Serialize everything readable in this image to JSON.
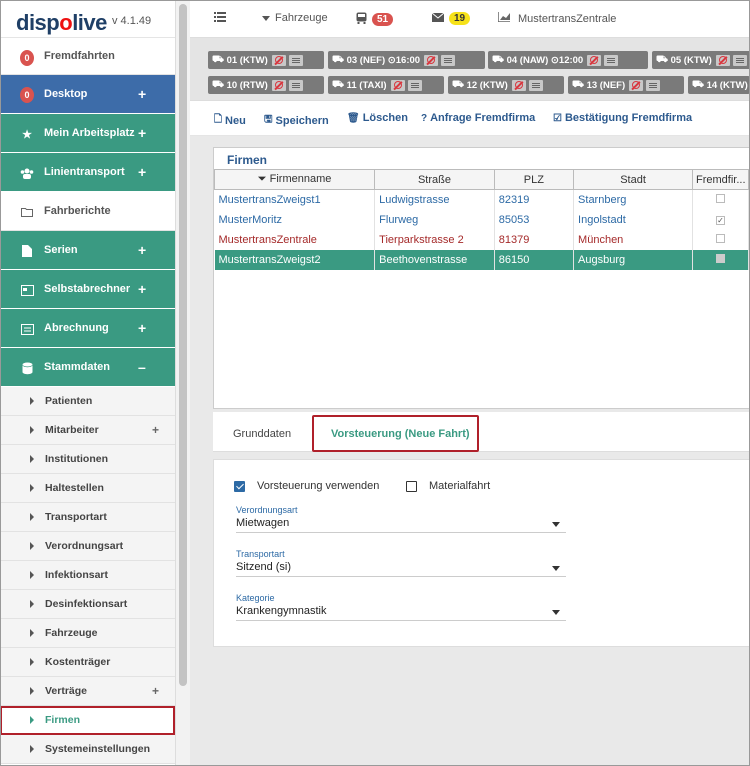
{
  "app": {
    "brand_a": "disp",
    "brand_o": "o",
    "brand_b": "live",
    "version": "v 4.1.49"
  },
  "sidebar": {
    "top": [
      {
        "label": "Fremdfahrten",
        "badge": "0"
      },
      {
        "label": "Desktop",
        "badge": "0"
      },
      {
        "label": "Mein Arbeitsplatz"
      },
      {
        "label": "Linientransport"
      },
      {
        "label": "Fahrberichte"
      },
      {
        "label": "Serien"
      },
      {
        "label": "Selbstabrechner"
      },
      {
        "label": "Abrechnung"
      },
      {
        "label": "Stammdaten"
      }
    ],
    "plus": "+",
    "minus": "–",
    "sub": [
      "Patienten",
      "Mitarbeiter",
      "Institutionen",
      "Haltestellen",
      "Transportart",
      "Verordnungsart",
      "Infektionsart",
      "Desinfektionsart",
      "Fahrzeuge",
      "Kostenträger",
      "Verträge",
      "Firmen",
      "Systemeinstellungen"
    ]
  },
  "topbar": {
    "vehicles": "Fahrzeuge",
    "bus_count": "51",
    "mail_count": "19",
    "company": "MustertransZentrale"
  },
  "vehicles": [
    {
      "label": "01 (KTW)"
    },
    {
      "label": "03 (NEF)",
      "time": "16:00"
    },
    {
      "label": "04 (NAW)",
      "time": "12:00"
    },
    {
      "label": "05 (KTW)"
    },
    {
      "label": "10 (RTW)"
    },
    {
      "label": "11 (TAXI)"
    },
    {
      "label": "12 (KTW)"
    },
    {
      "label": "13 (NEF)"
    },
    {
      "label": "14 (KTW)"
    }
  ],
  "toolbar": {
    "new": "Neu",
    "save": "Speichern",
    "delete": "Löschen",
    "request": "Anfrage Fremdfirma",
    "confirm": "Bestätigung Fremdfirma"
  },
  "firms": {
    "title": "Firmen",
    "columns": [
      "Firmenname",
      "Straße",
      "PLZ",
      "Stadt",
      "Fremdfir..."
    ],
    "rows": [
      [
        "MustertransZweigst1",
        "Ludwigstrasse",
        "82319",
        "Starnberg"
      ],
      [
        "MusterMoritz",
        "Flurweg",
        "85053",
        "Ingolstadt"
      ],
      [
        "MustertransZentrale",
        "Tierparkstrasse 2",
        "81379",
        "München"
      ],
      [
        "MustertransZweigst2",
        "Beethovenstrasse",
        "86150",
        "Augsburg"
      ]
    ]
  },
  "tabs": {
    "basic": "Grunddaten",
    "pretax": "Vorsteuerung (Neue Fahrt)"
  },
  "form": {
    "use_pretax": "Vorsteuerung verwenden",
    "material": "Materialfahrt",
    "order_type_label": "Verordnungsart",
    "order_type_value": "Mietwagen",
    "transport_label": "Transportart",
    "transport_value": "Sitzend (si)",
    "category_label": "Kategorie",
    "category_value": "Krankengymnastik"
  }
}
